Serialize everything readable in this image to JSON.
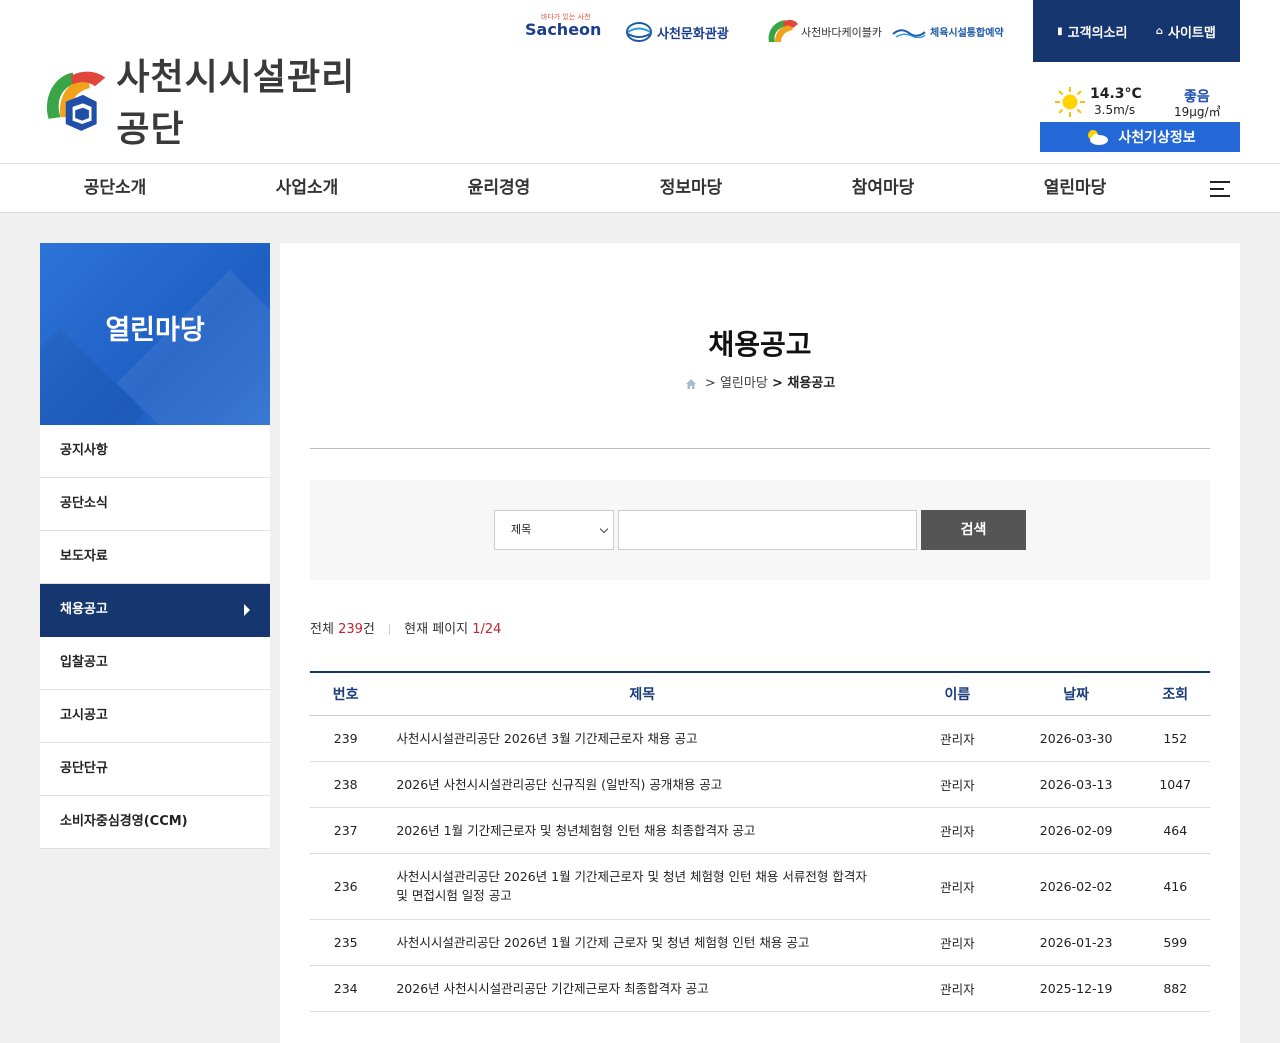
{
  "header": {
    "logo_text": "사천시시설관리공단",
    "partners": {
      "sacheon_sub": "바다가 있는 사천",
      "sacheon": "Sacheon",
      "culture": "사천문화관광",
      "cable": "사천바다케이블카",
      "sport": "체육시설통합예약"
    },
    "util": [
      {
        "label": "고객의소리",
        "icon": "document-icon"
      },
      {
        "label": "사이트맵",
        "icon": "home-icon"
      }
    ],
    "weather": {
      "temp": "14.3°C",
      "wind": "3.5m/s",
      "air": "좋음",
      "pm": "19μg/㎥",
      "button": "사천기상정보"
    }
  },
  "gnb": [
    "공단소개",
    "사업소개",
    "윤리경영",
    "정보마당",
    "참여마당",
    "열린마당"
  ],
  "sidebar": {
    "title": "열린마당",
    "items": [
      {
        "label": "공지사항"
      },
      {
        "label": "공단소식"
      },
      {
        "label": "보도자료"
      },
      {
        "label": "채용공고",
        "active": true
      },
      {
        "label": "입찰공고"
      },
      {
        "label": "고시공고"
      },
      {
        "label": "공단단규"
      },
      {
        "label": "소비자중심경영(CCM)"
      }
    ]
  },
  "content": {
    "title": "채용공고",
    "breadcrumb": {
      "sep": ">",
      "parent": "열린마당",
      "current": "채용공고"
    },
    "search": {
      "select": "제목",
      "input_value": "",
      "button": "검색"
    },
    "count": {
      "total_label": "전체",
      "total": "239",
      "unit": "건",
      "page_label": "현재 페이지",
      "page": "1/24"
    },
    "table": {
      "headers": [
        "번호",
        "제목",
        "이름",
        "날짜",
        "조회"
      ],
      "rows": [
        {
          "no": "239",
          "title": "사천시시설관리공단 2026년 3월 기간제근로자 채용 공고",
          "name": "관리자",
          "date": "2026-03-30",
          "views": "152"
        },
        {
          "no": "238",
          "title": "2026년 사천시시설관리공단 신규직원 (일반직) 공개채용 공고",
          "name": "관리자",
          "date": "2026-03-13",
          "views": "1047"
        },
        {
          "no": "237",
          "title": "2026년 1월 기간제근로자 및 청년체험형 인턴 채용 최종합격자 공고",
          "name": "관리자",
          "date": "2026-02-09",
          "views": "464"
        },
        {
          "no": "236",
          "title": "사천시시설관리공단 2026년 1월 기간제근로자 및 청년 체험형 인턴 채용 서류전형 합격자 및 면접시험 일정 공고",
          "name": "관리자",
          "date": "2026-02-02",
          "views": "416"
        },
        {
          "no": "235",
          "title": "사천시시설관리공단 2026년 1월 기간제 근로자 및 청년 체험형 인턴 채용 공고",
          "name": "관리자",
          "date": "2026-01-23",
          "views": "599"
        },
        {
          "no": "234",
          "title": "2026년 사천시시설관리공단 기간제근로자 최종합격자 공고",
          "name": "관리자",
          "date": "2025-12-19",
          "views": "882"
        }
      ]
    }
  },
  "colors": {
    "navy": "#15366f",
    "blue": "#2467d6",
    "red": "#c0262d"
  }
}
